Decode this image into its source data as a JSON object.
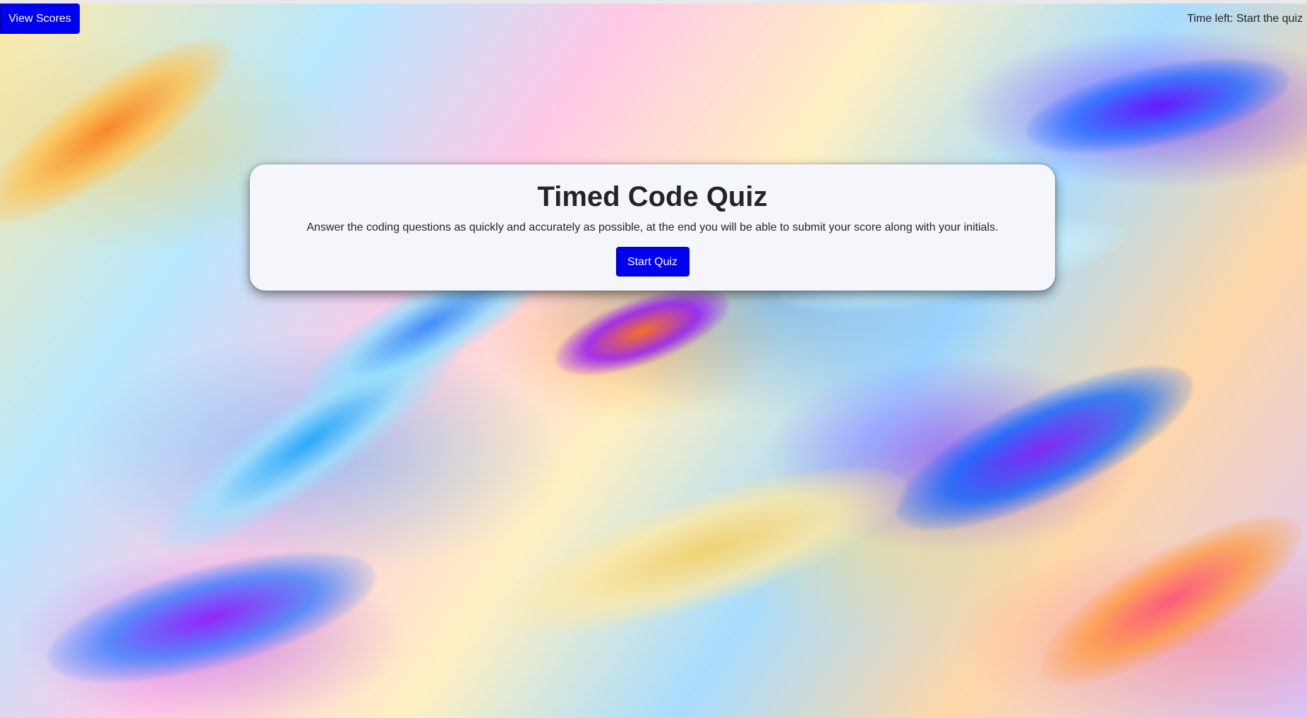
{
  "header": {
    "view_scores_label": "View Scores",
    "timer_text": "Time left: Start the quiz"
  },
  "quiz": {
    "title": "Timed Code Quiz",
    "instructions": "Answer the coding questions as quickly and accurately as possible, at the end you will be able to submit your score along with your initials.",
    "start_label": "Start Quiz"
  },
  "colors": {
    "button_bg": "#0000f0",
    "button_text": "#ffffff",
    "card_bg": "#f5f6fb",
    "text": "#212529"
  }
}
